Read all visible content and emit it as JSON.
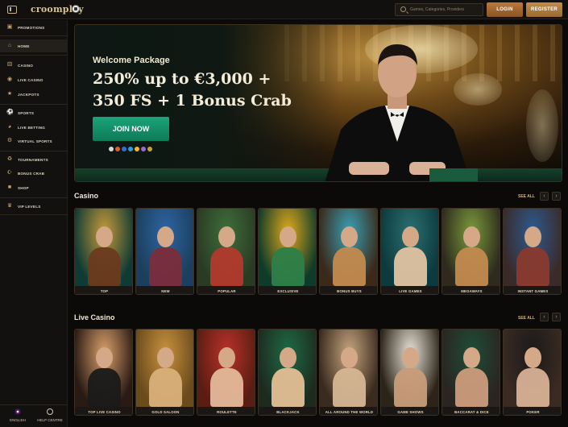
{
  "header": {
    "logo_text": "croompley",
    "search_placeholder": "Games, Categories, Providers",
    "login_label": "LOGIN",
    "register_label": "REGISTER"
  },
  "sidebar": {
    "items": [
      {
        "label": "PROMOTIONS",
        "icon": "gift-icon"
      },
      {
        "label": "HOME",
        "icon": "home-icon",
        "active": true
      },
      {
        "label": "CASINO",
        "icon": "dice-icon"
      },
      {
        "label": "LIVE CASINO",
        "icon": "live-icon"
      },
      {
        "label": "JACKPOTS",
        "icon": "jackpot-icon"
      },
      {
        "label": "SPORTS",
        "icon": "ball-icon"
      },
      {
        "label": "LIVE BETTING",
        "icon": "live-betting-icon"
      },
      {
        "label": "VIRTUAL SPORTS",
        "icon": "virtual-icon"
      },
      {
        "label": "TOURNAMENTS",
        "icon": "trophy-icon"
      },
      {
        "label": "BONUS CRAB",
        "icon": "crab-icon"
      },
      {
        "label": "SHOP",
        "icon": "shop-icon"
      },
      {
        "label": "VIP LEVELS",
        "icon": "crown-icon"
      }
    ],
    "footer": {
      "language_label": "ENGLISH",
      "help_label": "HELP CENTRE"
    }
  },
  "hero": {
    "welcome": "Welcome Package",
    "headline_line1": "250% up to €3,000 +",
    "headline_line2": "350 FS + 1 Bonus Crab",
    "cta_label": "JOIN NOW",
    "payment_colors": [
      "#d9d9d9",
      "#e25d2a",
      "#2f6fd6",
      "#29a0d9",
      "#f2b632",
      "#9a6ad1",
      "#c9a03e"
    ]
  },
  "casino_section": {
    "title": "Casino",
    "see_all": "SEE ALL",
    "cards": [
      "TOP",
      "NEW",
      "POPULAR",
      "EXCLUSIVE",
      "BONUS BUYS",
      "LIVE GAMES",
      "MEGAWAYS",
      "INSTANT GAMES"
    ]
  },
  "live_section": {
    "title": "Live Casino",
    "see_all": "SEE ALL",
    "cards": [
      "TOP LIVE CASINO",
      "GOLD SALOON",
      "ROULETTE",
      "BLACKJACK",
      "ALL AROUND THE WORLD",
      "GAME SHOWS",
      "BACCARAT & DICE",
      "POKER"
    ]
  },
  "nav_arrows": {
    "prev": "‹",
    "next": "›"
  },
  "colors": {
    "accent_gold": "#d8b270",
    "join_green": "#16956d",
    "login_orange": "#b9793a",
    "background": "#0b0a09"
  }
}
